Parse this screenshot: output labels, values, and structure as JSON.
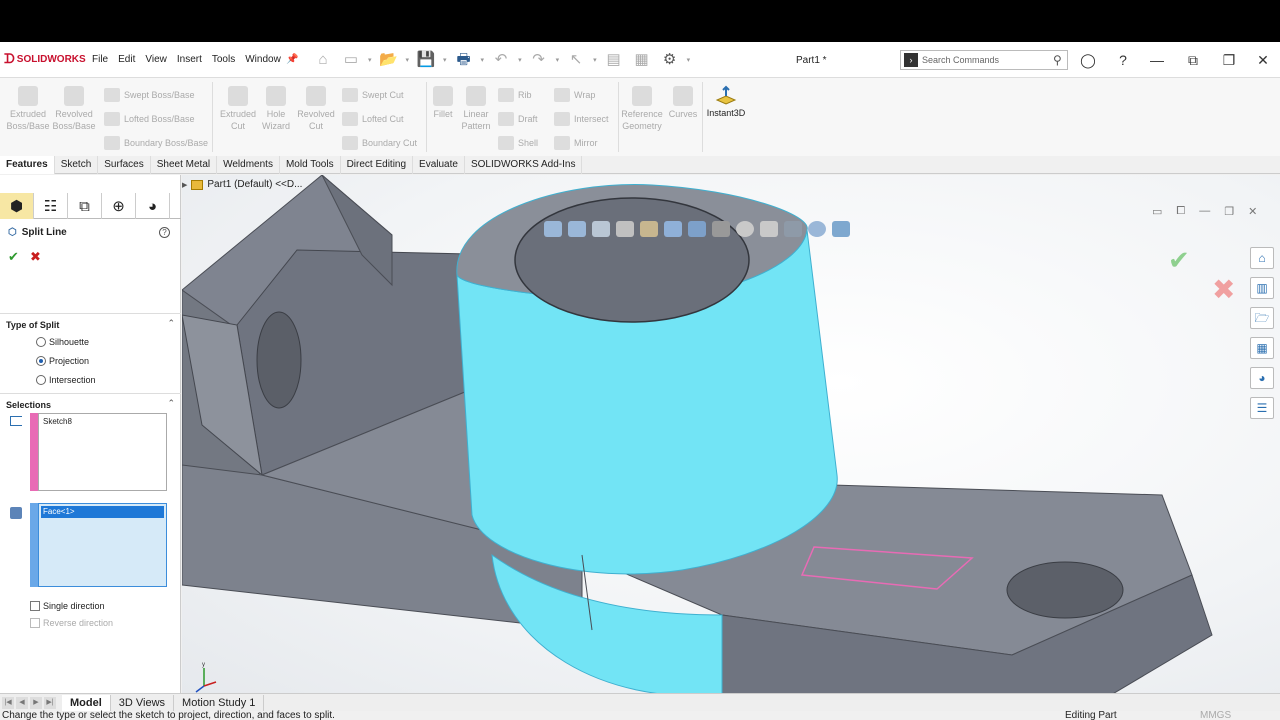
{
  "app": {
    "logo": "SOLIDWORKS",
    "doc_title": "Part1 *"
  },
  "menu": [
    "File",
    "Edit",
    "View",
    "Insert",
    "Tools",
    "Window"
  ],
  "search": {
    "placeholder": "Search Commands"
  },
  "commands": {
    "extruded_boss": "Extruded Boss/Base",
    "revolved_boss": "Revolved Boss/Base",
    "swept_boss": "Swept Boss/Base",
    "lofted_boss": "Lofted Boss/Base",
    "boundary_boss": "Boundary Boss/Base",
    "extruded_cut": "Extruded Cut",
    "hole_wizard": "Hole Wizard",
    "revolved_cut": "Revolved Cut",
    "swept_cut": "Swept Cut",
    "lofted_cut": "Lofted Cut",
    "boundary_cut": "Boundary Cut",
    "fillet": "Fillet",
    "linear_pattern": "Linear Pattern",
    "rib": "Rib",
    "draft": "Draft",
    "shell": "Shell",
    "wrap": "Wrap",
    "intersect": "Intersect",
    "mirror": "Mirror",
    "reference_geometry": "Reference Geometry",
    "curves": "Curves",
    "instant3d": "Instant3D"
  },
  "tabs": [
    "Features",
    "Sketch",
    "Surfaces",
    "Sheet Metal",
    "Weldments",
    "Mold Tools",
    "Direct Editing",
    "Evaluate",
    "SOLIDWORKS Add-Ins"
  ],
  "tree": {
    "label": "Part1 (Default) <<D..."
  },
  "property_manager": {
    "title": "Split Line",
    "type_group": {
      "title": "Type of Split",
      "options": [
        "Silhouette",
        "Projection",
        "Intersection"
      ],
      "selected": "Projection"
    },
    "selections_group": {
      "title": "Selections",
      "sketch_item": "Sketch8",
      "face_item": "Face<1>",
      "single_direction": "Single direction",
      "reverse_direction": "Reverse direction"
    }
  },
  "bottom_tabs": [
    "Model",
    "3D Views",
    "Motion Study 1"
  ],
  "status": {
    "message": "Change the type or select the sketch to project, direction, and faces to split.",
    "mode": "Editing Part",
    "units": "MMGS"
  },
  "colors": {
    "part_gray": "#808590",
    "highlight_cyan": "#6fe3f5",
    "accent": "#c8102e"
  }
}
